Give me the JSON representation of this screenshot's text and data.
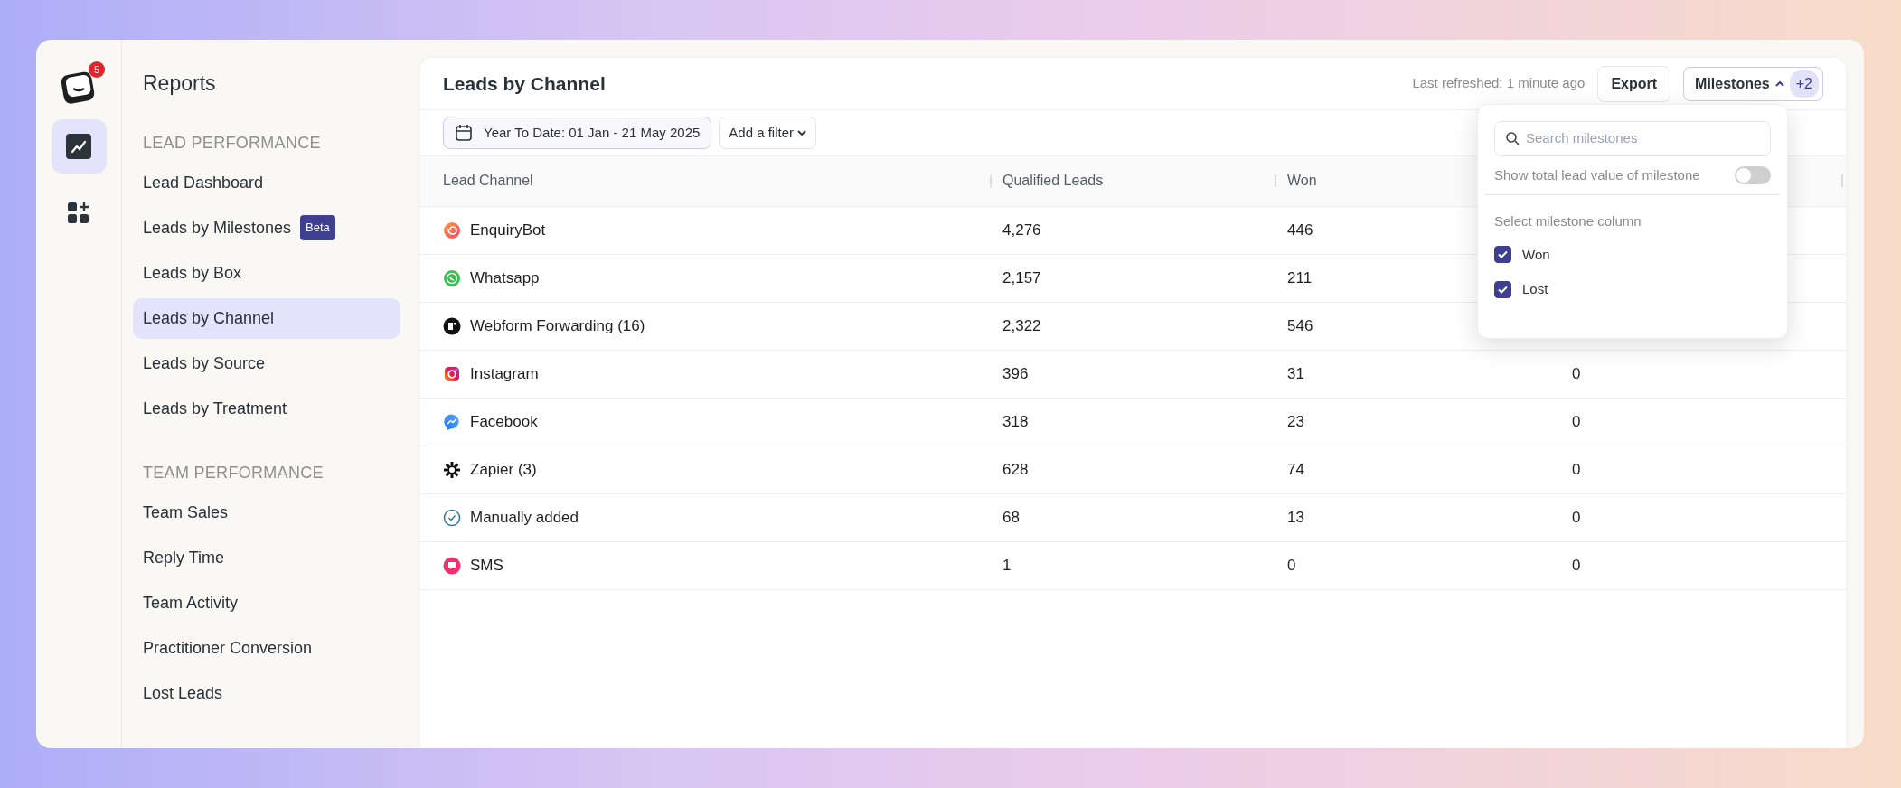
{
  "app": {
    "notification_count": "5"
  },
  "rail": [
    {
      "kind": "chart",
      "selected": true
    },
    {
      "kind": "apps",
      "selected": false
    }
  ],
  "sidebar": {
    "title": "Reports",
    "sections": [
      {
        "heading": "LEAD PERFORMANCE",
        "items": [
          {
            "label": "Lead Dashboard",
            "selected": false
          },
          {
            "label": "Leads by Milestones",
            "badge": "Beta",
            "selected": false
          },
          {
            "label": "Leads by Box",
            "selected": false
          },
          {
            "label": "Leads by Channel",
            "selected": true
          },
          {
            "label": "Leads by Source",
            "selected": false
          },
          {
            "label": "Leads by Treatment",
            "selected": false
          }
        ]
      },
      {
        "heading": "TEAM PERFORMANCE",
        "items": [
          {
            "label": "Team Sales",
            "selected": false
          },
          {
            "label": "Reply Time",
            "selected": false
          },
          {
            "label": "Team Activity",
            "selected": false
          },
          {
            "label": "Practitioner Conversion",
            "selected": false
          },
          {
            "label": "Lost Leads",
            "selected": false
          }
        ]
      }
    ]
  },
  "report": {
    "title": "Leads by Channel",
    "last_refreshed": "Last refreshed: 1 minute ago",
    "export": "Export",
    "milestones": {
      "label": "Milestones",
      "count": "+2",
      "expanded": true
    }
  },
  "filters": {
    "date_range": "Year To Date: 01 Jan - 21 May 2025",
    "add_filter": "Add a filter"
  },
  "table": {
    "columns": [
      "Lead Channel",
      "Qualified Leads",
      "Won"
    ],
    "rows": [
      {
        "kind": "bot",
        "cells": [
          "EnquiryBot",
          "4,276",
          "446"
        ]
      },
      {
        "kind": "phone",
        "cells": [
          "Whatsapp",
          "2,157",
          "211"
        ]
      },
      {
        "kind": "form",
        "cells": [
          "Webform Forwarding (16)",
          "2,322",
          "546"
        ]
      },
      {
        "kind": "camera",
        "cells": [
          "Instagram",
          "396",
          "31",
          "0"
        ]
      },
      {
        "kind": "messenger",
        "cells": [
          "Facebook",
          "318",
          "23",
          "0"
        ]
      },
      {
        "kind": "asterisk",
        "cells": [
          "Zapier (3)",
          "628",
          "74",
          "0"
        ]
      },
      {
        "kind": "check",
        "cells": [
          "Manually added",
          "68",
          "13",
          "0"
        ]
      },
      {
        "kind": "sms",
        "cells": [
          "SMS",
          "1",
          "0",
          "0"
        ]
      }
    ]
  },
  "milestone_menu": {
    "search_placeholder": "Search milestones",
    "toggle": {
      "label": "Show total lead value of milestone",
      "on": false
    },
    "section": "Select milestone column",
    "options": [
      {
        "label": "Won",
        "checked": true
      },
      {
        "label": "Lost",
        "checked": true
      }
    ]
  }
}
